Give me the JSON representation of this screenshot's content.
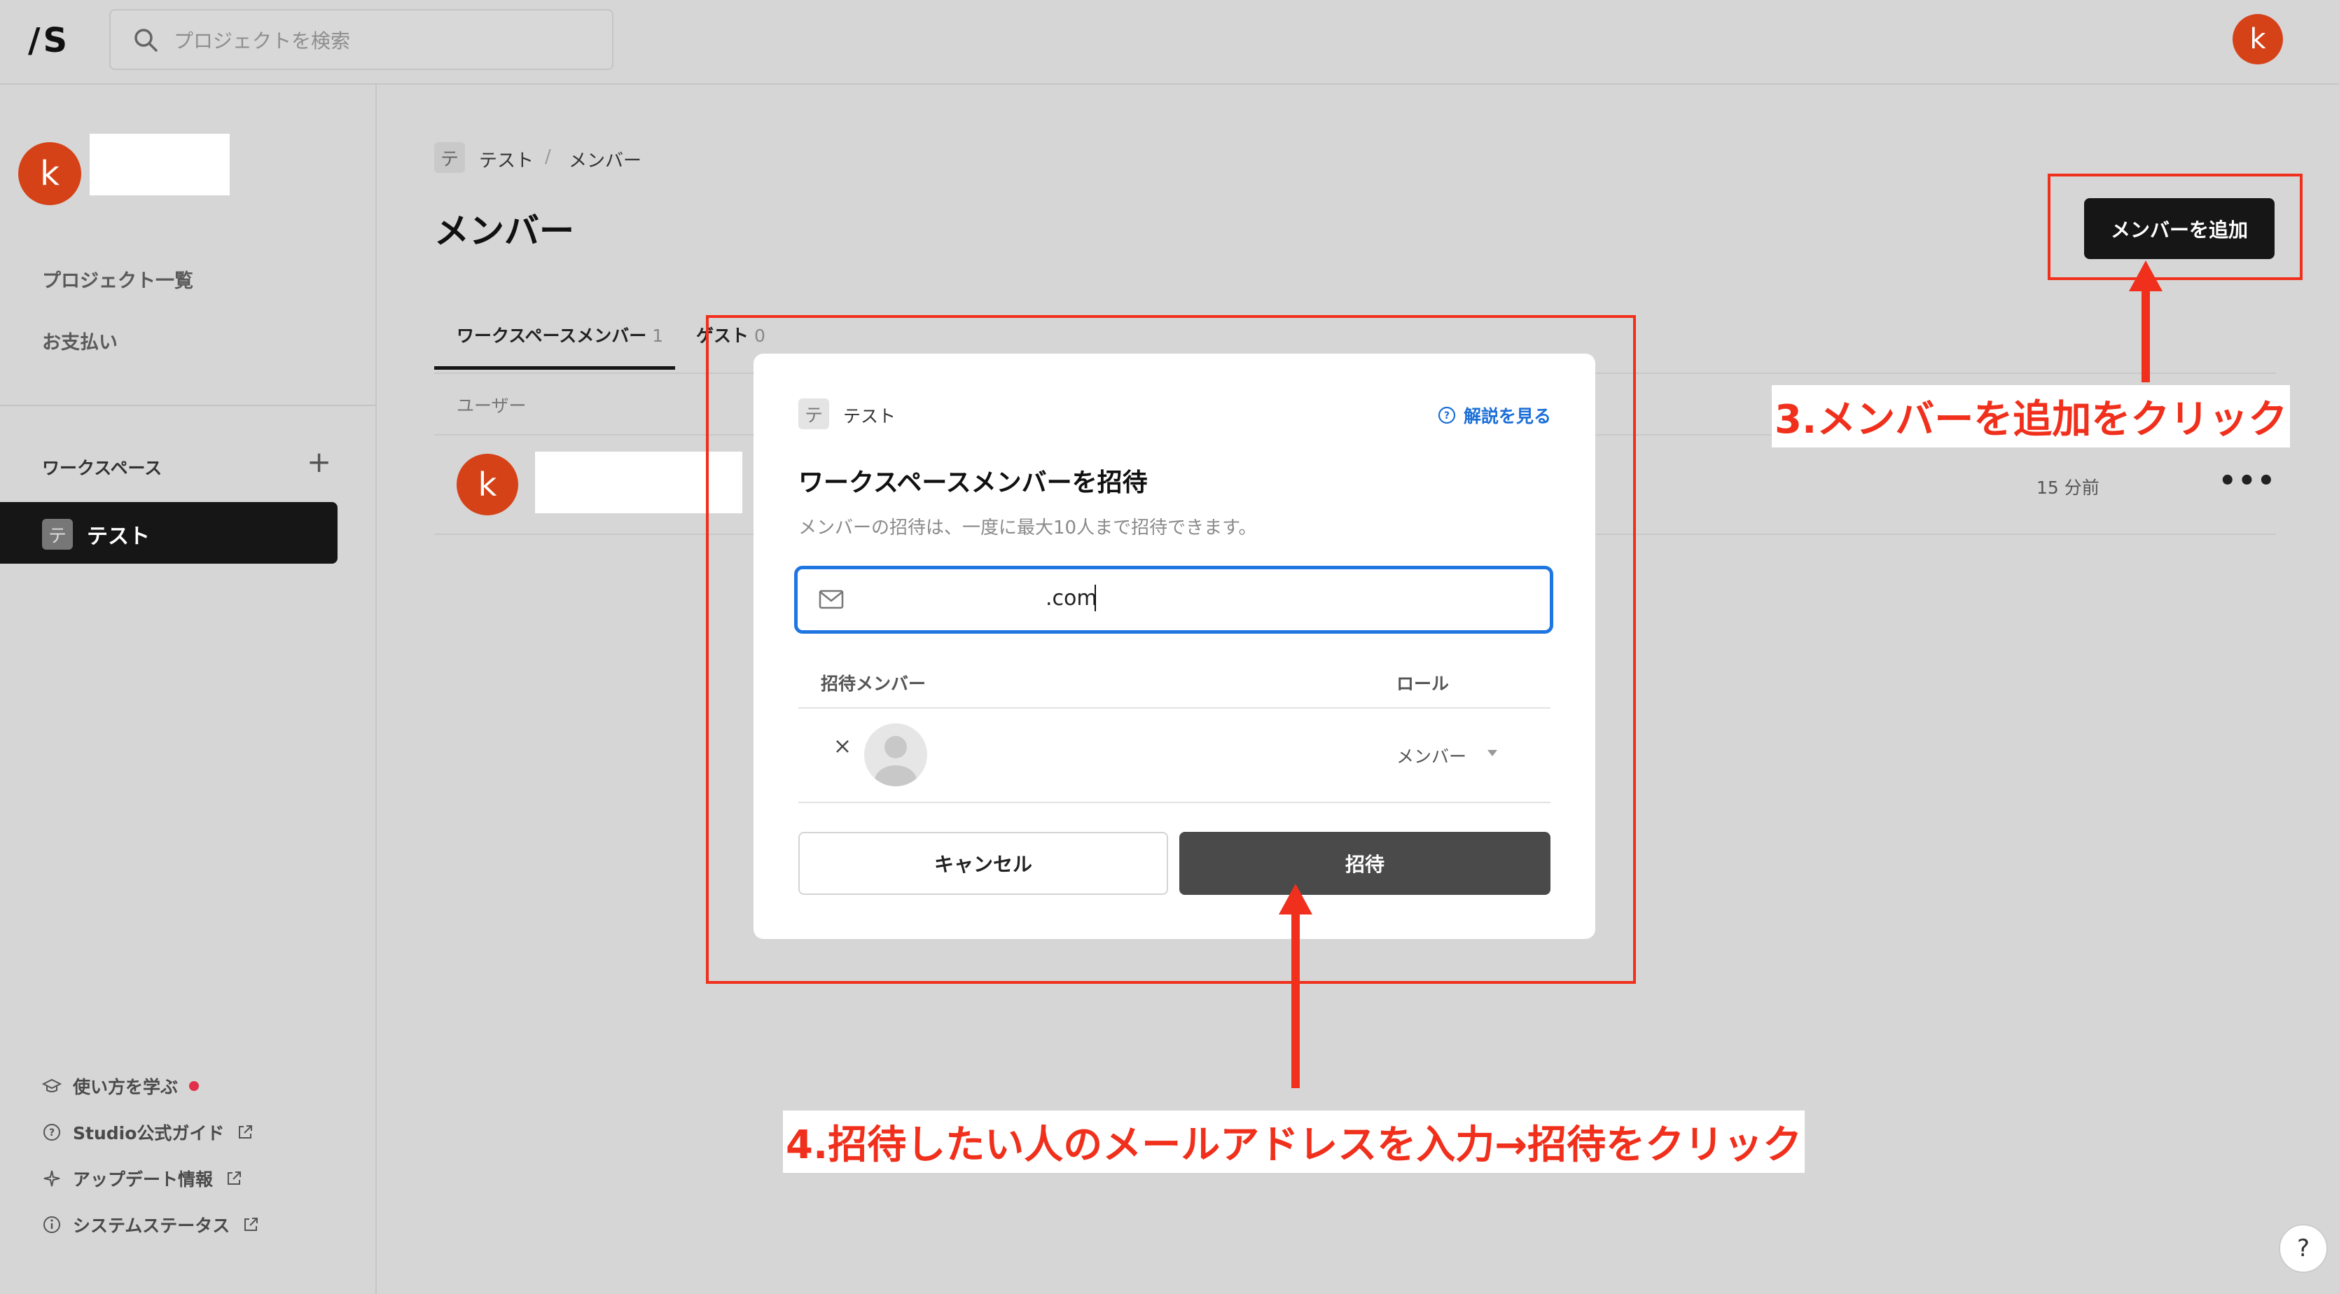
{
  "topbar": {
    "logo": "/S",
    "search_placeholder": "プロジェクトを検索",
    "avatar_letter": "k"
  },
  "sidebar": {
    "avatar_letter": "k",
    "nav": [
      "プロジェクト一覧",
      "お支払い"
    ],
    "workspace_label": "ワークスペース",
    "workspace_add": "+",
    "workspace_item": {
      "icon": "テ",
      "label": "テスト"
    },
    "footer": [
      {
        "icon": "graduation-cap-icon",
        "label": "使い方を学ぶ"
      },
      {
        "icon": "question-circle-icon",
        "label": "Studio公式ガイド"
      },
      {
        "icon": "sparkle-icon",
        "label": "アップデート情報"
      },
      {
        "icon": "info-circle-icon",
        "label": "システムステータス"
      }
    ]
  },
  "main": {
    "breadcrumb": {
      "icon": "テ",
      "workspace": "テスト",
      "separator": "/",
      "page": "メンバー"
    },
    "title": "メンバー",
    "add_button": "メンバーを追加",
    "tabs": [
      {
        "label": "ワークスペースメンバー",
        "count": "1"
      },
      {
        "label": "ゲスト",
        "count": "0"
      }
    ],
    "column_user": "ユーザー",
    "row": {
      "avatar_letter": "k",
      "time": "15 分前",
      "more": "•••"
    }
  },
  "modal": {
    "ws_icon": "テ",
    "ws_label": "テスト",
    "help_link": "解説を見る",
    "title": "ワークスペースメンバーを招待",
    "description": "メンバーの招待は、一度に最大10人まで招待できます。",
    "email_value": ".com",
    "col_member": "招待メンバー",
    "col_role": "ロール",
    "role_value": "メンバー",
    "cancel": "キャンセル",
    "invite": "招待"
  },
  "annotations": {
    "step3": "3.メンバーを追加をクリック",
    "step4": "4.招待したい人のメールアドレスを入力→招待をクリック",
    "color": "#f0301c"
  },
  "help_fab": "?"
}
